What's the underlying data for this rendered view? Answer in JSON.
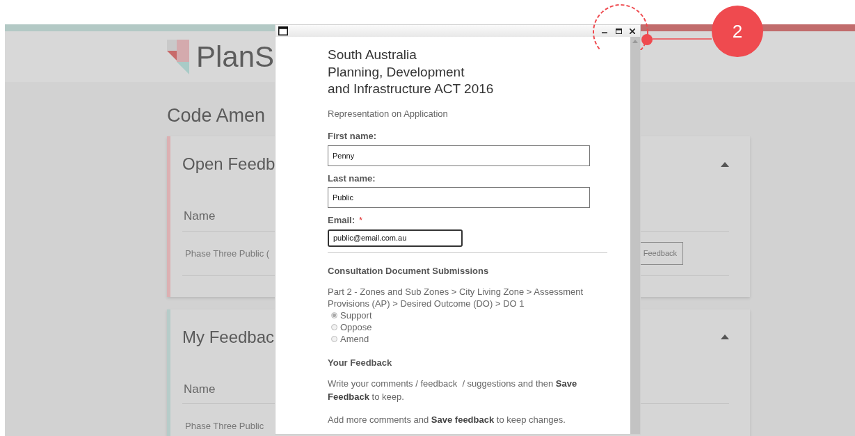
{
  "header": {
    "logo_text": "PlanS"
  },
  "page_title": "Code Amen",
  "cards": [
    {
      "title": "Open Feedb",
      "color": "#dcb0b2",
      "expanded": true,
      "column_header": "Name",
      "rows": [
        {
          "name": "Phase Three Public (",
          "button": "Feedback"
        }
      ]
    },
    {
      "title": "My Feedbac",
      "color": "#b6ccc9",
      "expanded": true,
      "column_header": "Name",
      "rows": [
        {
          "name": "Phase Three Public"
        }
      ]
    }
  ],
  "popup": {
    "form_title": [
      "South Australia",
      "Planning, Development",
      "and Infrastructure ACT 2016"
    ],
    "subtitle": "Representation on Application",
    "fields": [
      {
        "label": "First name:",
        "value": "Penny",
        "focused": false
      },
      {
        "label": "Last name:",
        "value": "Public",
        "focused": false
      },
      {
        "label": "Email:",
        "required_mark": "*",
        "value": "public@email.com.au",
        "focused": true
      }
    ],
    "section_title": "Consultation Document Submissions",
    "breadcrumb": "Part 2 - Zones and Sub Zones > City Living Zone > Assessment Provisions (AP) > Desired Outcome (DO) > DO 1",
    "options": [
      {
        "label": "Support",
        "selected": true
      },
      {
        "label": "Oppose",
        "selected": false
      },
      {
        "label": "Amend",
        "selected": false
      }
    ],
    "feedback_title": "Your Feedback",
    "instructions": [
      "Write your comments / feedback  / suggestions and then **Save Feedback** to keep.",
      "Add more comments and **Save feedback** to keep changes."
    ]
  },
  "callout": {
    "number": "2"
  }
}
